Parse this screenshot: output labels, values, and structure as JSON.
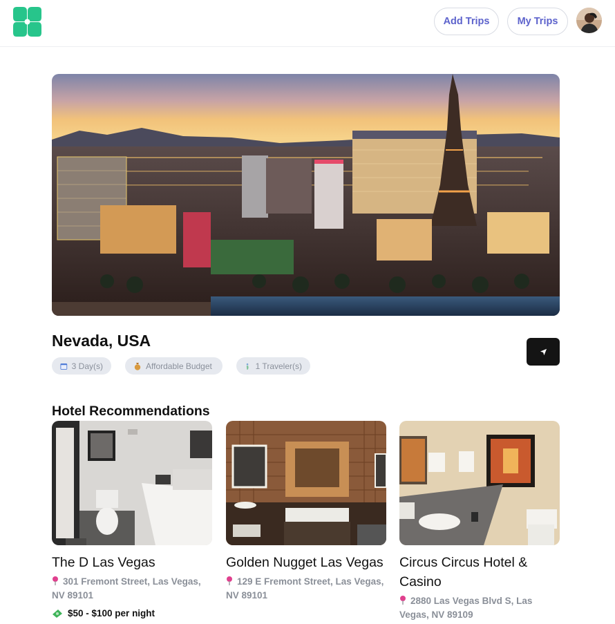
{
  "header": {
    "add_trips_label": "Add Trips",
    "my_trips_label": "My Trips"
  },
  "trip": {
    "destination": "Nevada, USA",
    "chips": {
      "days": "3 Day(s)",
      "budget": "Affordable Budget",
      "travelers": "1 Traveler(s)"
    }
  },
  "hotels": {
    "section_title": "Hotel Recommendations",
    "items": [
      {
        "name": "The D Las Vegas",
        "address": "301 Fremont Street, Las Vegas, NV 89101",
        "price": "$50 - $100 per night"
      },
      {
        "name": "Golden Nugget Las Vegas",
        "address": "129 E Fremont Street, Las Vegas, NV 89101"
      },
      {
        "name": "Circus Circus Hotel & Casino",
        "address": "2880 Las Vegas Blvd S, Las Vegas, NV 89109"
      }
    ]
  },
  "colors": {
    "brand_green": "#27c58b",
    "button_text": "#5d63cc",
    "chip_bg": "#e6e9ef",
    "pin_color": "#e0408e"
  },
  "icons": {
    "logo": "clover-logo",
    "share": "send-icon",
    "pin": "pin-icon",
    "money": "money-icon"
  }
}
